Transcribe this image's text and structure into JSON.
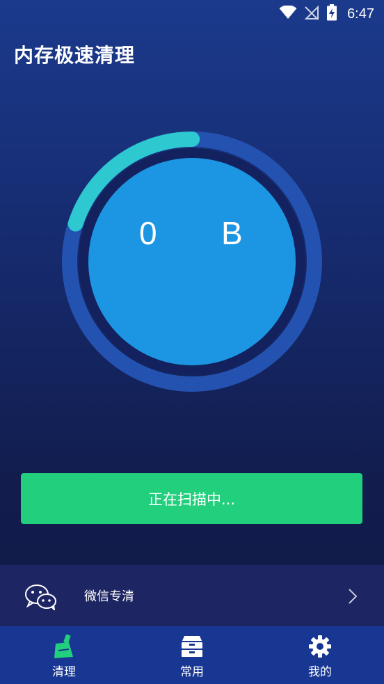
{
  "status_bar": {
    "time": "6:47"
  },
  "header": {
    "title": "内存极速清理"
  },
  "gauge": {
    "size_value": "0",
    "size_unit": "B",
    "progress": 0.2
  },
  "scan": {
    "button_label": "正在扫描中..."
  },
  "wechat": {
    "label": "微信专清",
    "icon": "wechat-icon"
  },
  "bottom_nav": {
    "items": [
      {
        "label": "清理",
        "icon": "broom-icon"
      },
      {
        "label": "常用",
        "icon": "drawer-icon"
      },
      {
        "label": "我的",
        "icon": "gear-icon"
      }
    ]
  },
  "colors": {
    "accent_green": "#21cf7d",
    "ring_track": "#2452b0",
    "ring_progress": "#2ec8d0",
    "inner_circle": "#1c95e2"
  }
}
